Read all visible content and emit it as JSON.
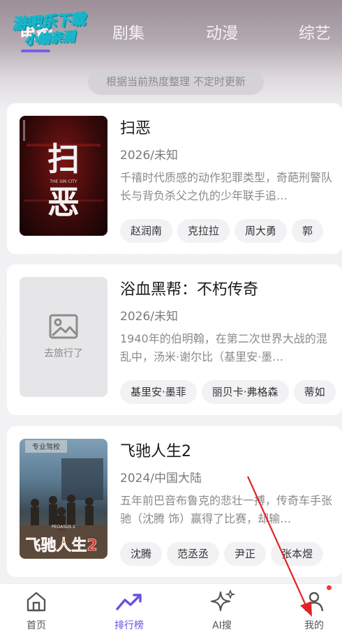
{
  "tabs": [
    {
      "label": "电影",
      "active": true
    },
    {
      "label": "剧集",
      "active": false
    },
    {
      "label": "动漫",
      "active": false
    },
    {
      "label": "综艺",
      "active": false
    }
  ],
  "watermark": {
    "line1": "游吧乐下载",
    "line2": "小编亲测"
  },
  "notice": "根据当前热度整理 不定时更新",
  "items": [
    {
      "title": "扫恶",
      "meta": "2026/未知",
      "desc": "千禧时代质感的动作犯罪类型，奇葩刑警队长与背负杀父之仇的少年联手追…",
      "tags": [
        "赵润南",
        "克拉拉",
        "周大勇",
        "郭"
      ],
      "poster": {
        "big_text": "扫恶",
        "sub_text": "THE SIN CITY"
      }
    },
    {
      "title": "浴血黑帮：不朽传奇",
      "meta": "2026/未知",
      "desc": "1940年的伯明翰，在第二次世界大战的混乱中，汤米·谢尔比（基里安·墨…",
      "tags": [
        "基里安·墨菲",
        "丽贝卡·弗格森",
        "蒂如"
      ],
      "placeholder_text": "去旅行了"
    },
    {
      "title": "飞驰人生2",
      "meta": "2024/中国大陆",
      "desc": "五年前巴音布鲁克的悲壮一搏，传奇车手张驰（沈腾 饰）赢得了比赛，却输…",
      "tags": [
        "沈腾",
        "范丞丞",
        "尹正",
        "张本煜"
      ],
      "poster": {
        "big_text": "飞驰人生2",
        "sign_text": "专业驾校",
        "top_text": "PEGASUS 2"
      }
    }
  ],
  "nav": [
    {
      "label": "首页",
      "icon": "home-icon",
      "active": false
    },
    {
      "label": "排行榜",
      "icon": "trending-icon",
      "active": true
    },
    {
      "label": "AI搜",
      "icon": "sparkle-icon",
      "active": false
    },
    {
      "label": "我的",
      "icon": "person-icon",
      "active": false,
      "badge": true
    }
  ],
  "colors": {
    "accent": "#6b4fe0",
    "badge": "#f03a3a",
    "arrow": "#e02424"
  }
}
